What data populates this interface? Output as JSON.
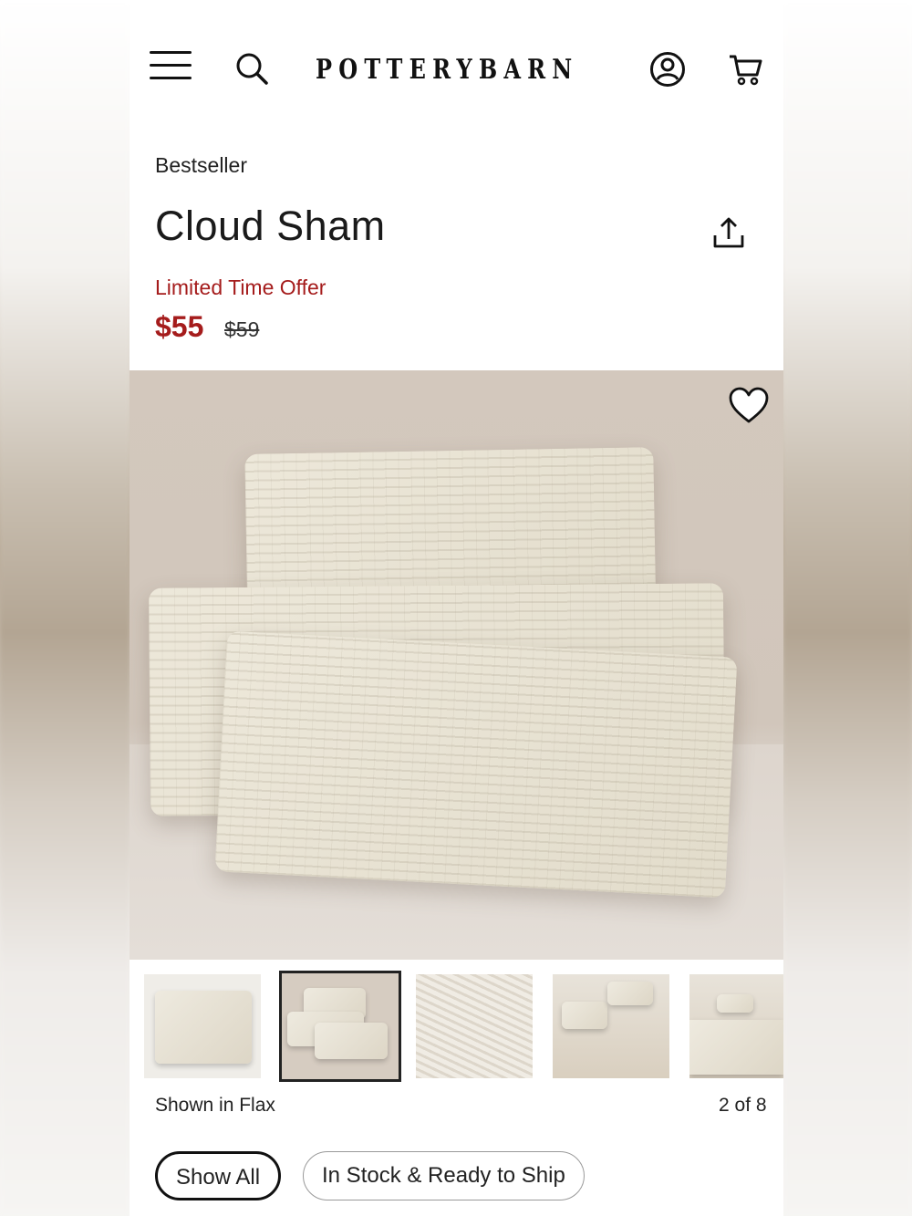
{
  "header": {
    "brand": "POTTERYBARN",
    "icons": [
      "menu-icon",
      "search-icon",
      "account-icon",
      "cart-icon"
    ]
  },
  "product": {
    "badge": "Bestseller",
    "title": "Cloud Sham",
    "promo": "Limited Time Offer",
    "sale_price": "$55",
    "original_price": "$59",
    "share_icon": "share-icon",
    "favorite_icon": "heart-icon"
  },
  "gallery": {
    "color_caption": "Shown in Flax",
    "position": "2 of 8",
    "selected_index": 1,
    "thumbnail_count_visible": 5
  },
  "filters": {
    "chips": [
      "Show All",
      "In Stock & Ready to Ship"
    ],
    "selected": "Show All"
  },
  "colors": {
    "sale_red": "#a51c1c",
    "text": "#1a1a1a"
  }
}
